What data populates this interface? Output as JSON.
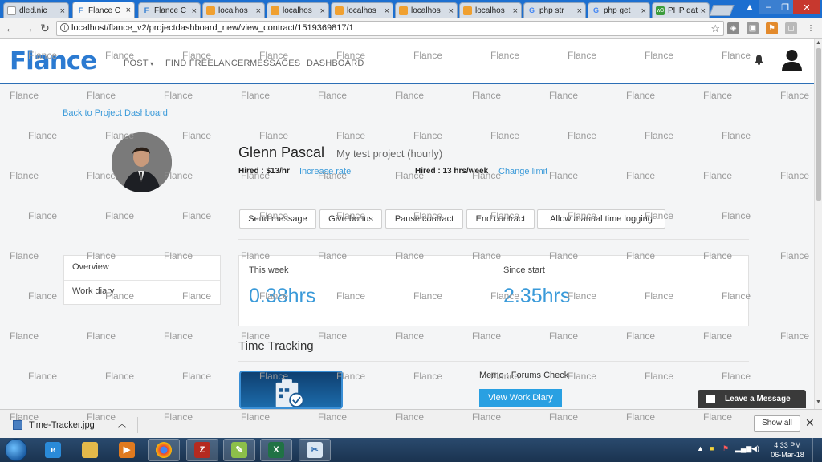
{
  "browser": {
    "tabs": [
      {
        "label": "dled.nic",
        "icon": "page-icon",
        "active": false
      },
      {
        "label": "Flance C",
        "icon": "flance-icon",
        "active": true
      },
      {
        "label": "Flance C",
        "icon": "flance-icon",
        "active": false
      },
      {
        "label": "localhos",
        "icon": "pma-icon",
        "active": false
      },
      {
        "label": "localhos",
        "icon": "pma-icon",
        "active": false
      },
      {
        "label": "localhos",
        "icon": "pma-icon",
        "active": false
      },
      {
        "label": "localhos",
        "icon": "pma-icon",
        "active": false
      },
      {
        "label": "localhos",
        "icon": "pma-icon",
        "active": false
      },
      {
        "label": "php str",
        "icon": "google-icon",
        "active": false
      },
      {
        "label": "php get",
        "icon": "google-icon",
        "active": false
      },
      {
        "label": "PHP dat",
        "icon": "php-icon",
        "active": false
      }
    ],
    "url": "localhost/flance_v2/projectdashboard_new/view_contract/1519369817/1"
  },
  "site": {
    "logo": "Flance",
    "nav": [
      "POST",
      "FIND FREELANCER",
      "MESSAGES",
      "DASHBOARD"
    ]
  },
  "contract": {
    "back_link": "Back to Project Dashboard",
    "name": "Glenn Pascal",
    "project": "My test project (hourly)",
    "hired_rate": "Hired : $13/hr",
    "increase_rate": "Increase rate",
    "hired_limit": "Hired : 13 hrs/week",
    "change_limit": "Change limit",
    "actions": [
      "Send message",
      "Give bonus",
      "Pause contract",
      "End contract",
      "Allow manual time logging"
    ]
  },
  "sidemenu": [
    "Overview",
    "Work diary"
  ],
  "stats": {
    "this_week_label": "This week",
    "this_week_value": "0.38hrs",
    "since_start_label": "Since start",
    "since_start_value": "2.35hrs"
  },
  "tracking": {
    "heading": "Time Tracking",
    "memo": "Memo : Forums Check",
    "view_button": "View Work Diary"
  },
  "chat": {
    "label": "Leave a Message"
  },
  "watermark": "Flance",
  "download": {
    "file": "Time-Tracker.jpg",
    "show_all": "Show all"
  },
  "taskbar": {
    "time": "4:33 PM",
    "date": "06-Mar-18"
  }
}
